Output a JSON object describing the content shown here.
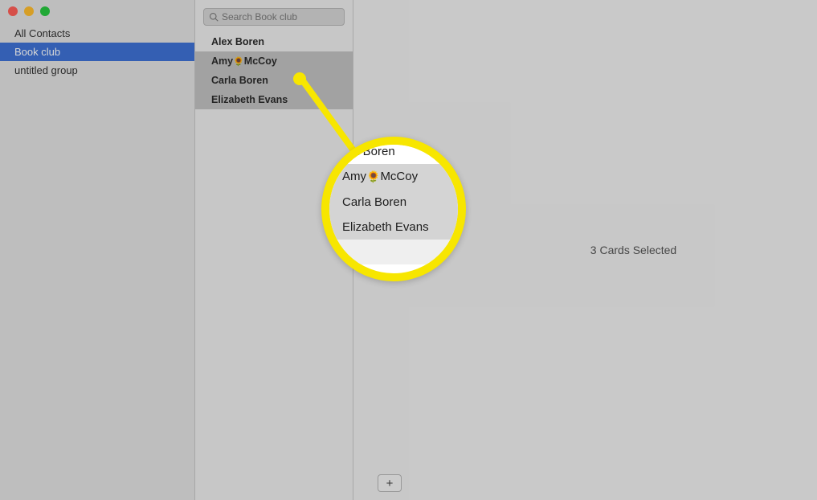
{
  "sidebar": {
    "items": [
      {
        "label": "All Contacts",
        "selected": false
      },
      {
        "label": "Book club",
        "selected": true
      },
      {
        "label": "untitled group",
        "selected": false
      }
    ]
  },
  "search": {
    "placeholder": "Search Book club"
  },
  "contacts": [
    {
      "name_pre": "Alex Boren",
      "name_post": "",
      "emoji": "",
      "selected": false
    },
    {
      "name_pre": "Amy",
      "emoji": "🌻",
      "name_post": "McCoy",
      "selected": true
    },
    {
      "name_pre": "Carla Boren",
      "name_post": "",
      "emoji": "",
      "selected": true
    },
    {
      "name_pre": "Elizabeth Evans",
      "name_post": "",
      "emoji": "",
      "selected": true
    }
  ],
  "detail": {
    "status": "3 Cards Selected"
  },
  "add_button": {
    "label": "+"
  },
  "magnifier": {
    "rows": [
      {
        "pre": "x Boren",
        "emoji": "",
        "post": "",
        "cls": "first"
      },
      {
        "pre": "Amy",
        "emoji": "🌻",
        "post": "McCoy",
        "cls": "sel"
      },
      {
        "pre": "Carla Boren",
        "emoji": "",
        "post": "",
        "cls": "sel"
      },
      {
        "pre": "Elizabeth Evans",
        "emoji": "",
        "post": "",
        "cls": "sel"
      },
      {
        "pre": "",
        "emoji": "",
        "post": "",
        "cls": "last"
      }
    ]
  }
}
